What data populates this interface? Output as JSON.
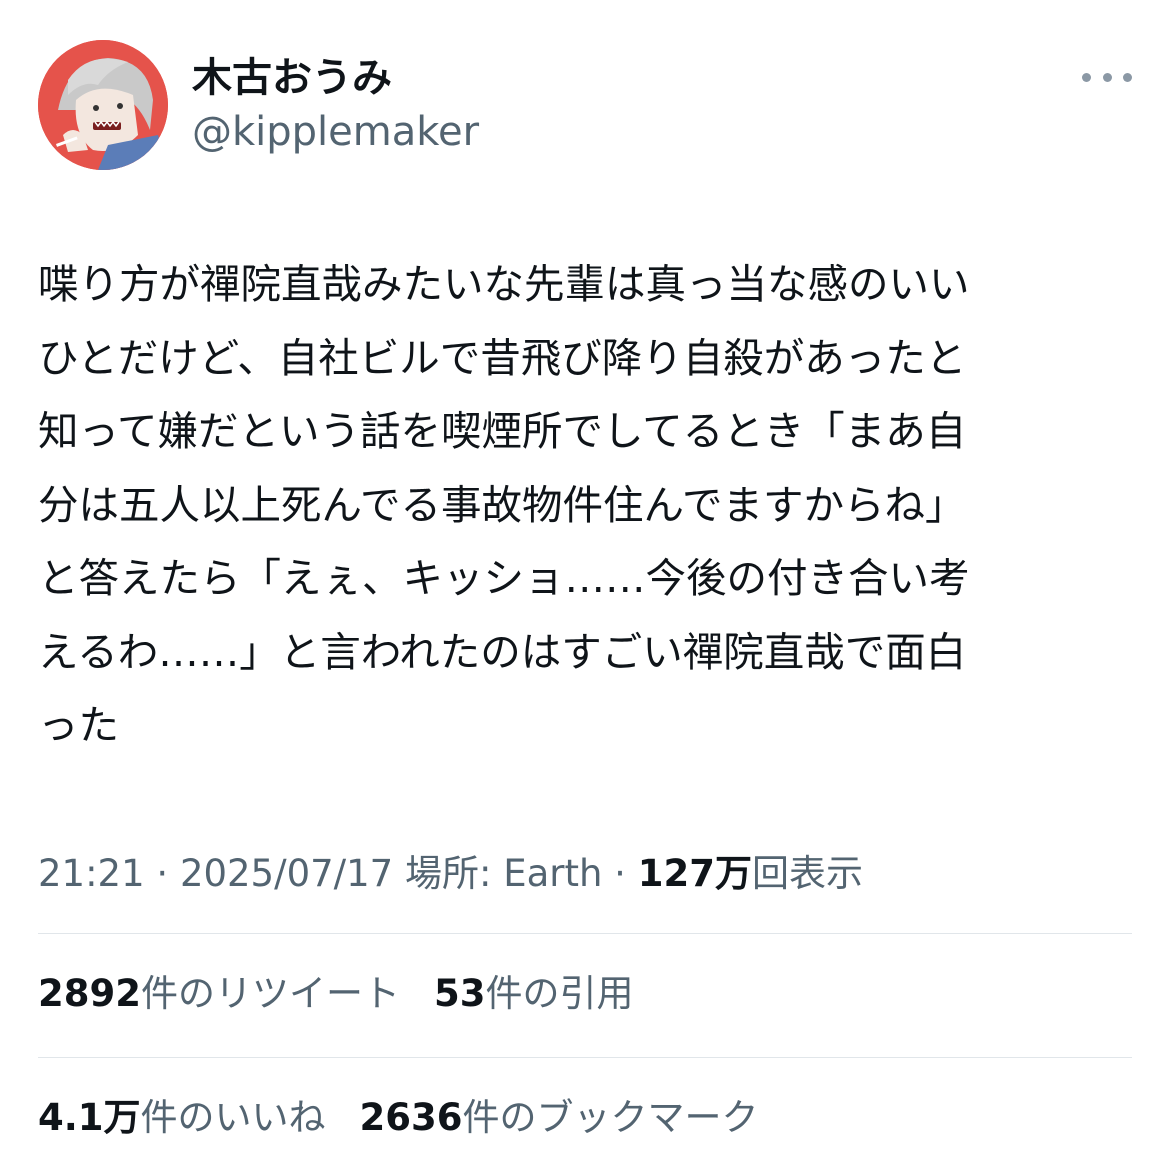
{
  "author": {
    "display_name": "木古おうみ",
    "handle": "@kipplemaker",
    "avatar_icon": "user-avatar-illustration"
  },
  "more_icon": "more-horizontal-icon",
  "tweet": {
    "lines": [
      "喋り方が禪院直哉みたいな先輩は真っ当な感のいい",
      "ひとだけど、自社ビルで昔飛び降り自殺があったと",
      "知って嫌だという話を喫煙所でしてるとき「まあ自",
      "分は五人以上死んでる事故物件住んでますからね」",
      "と答えたら「えぇ、キッショ……今後の付き合い考",
      "えるわ……」と言われたのはすごい禪院直哉で面白",
      "った"
    ]
  },
  "meta": {
    "time": "21:21",
    "sep1": " · ",
    "date": "2025/07/17",
    "location": " 場所: Earth",
    "sep2": " · ",
    "views_count": "127万",
    "views_label": "回表示"
  },
  "stats": {
    "retweets_count": "2892",
    "retweets_label": "件のリツイート",
    "quotes_count": "53",
    "quotes_label": "件の引用",
    "likes_count": "4.1万",
    "likes_label": "件のいいね",
    "bookmarks_count": "2636",
    "bookmarks_label": "件のブックマーク"
  },
  "colors": {
    "text_primary": "#0f1419",
    "text_secondary": "#536471",
    "divider": "#e1e6ea",
    "avatar_bg": "#e5534b"
  }
}
